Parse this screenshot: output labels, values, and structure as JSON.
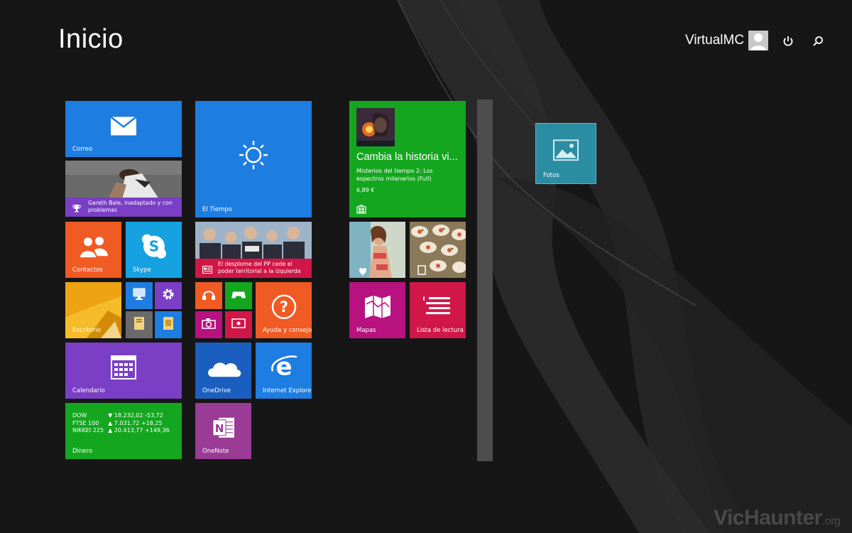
{
  "header": {
    "title": "Inicio",
    "username": "VirtualMC"
  },
  "tiles": {
    "correo": "Correo",
    "news_bale": "Gareth Bale, inadaptado y con problemas",
    "tiempo": "El Tiempo",
    "contactos": "Contactos",
    "skype": "Skype",
    "news_pp": "El desplome del PP cede el poder territorial a la izquierda",
    "escritorio": "Escritorio",
    "ayuda": "Ayuda y consejos",
    "calendario": "Calendario",
    "onedrive": "OneDrive",
    "ie": "Internet Explorer",
    "onenote": "OneNote",
    "dinero": "Dinero",
    "mapas": "Mapas",
    "lectura": "Lista de lectura",
    "fotos": "Fotos"
  },
  "store": {
    "headline": "Cambia la historia vi...",
    "subtitle": "Misterios del tiempo 2: Los espectros milenarios (Full)",
    "price": "6,89 €"
  },
  "markets": [
    {
      "name": "DOW",
      "arrow": "▼",
      "value": "18.232,02",
      "change": "-53,72"
    },
    {
      "name": "FTSE 100",
      "arrow": "▲",
      "value": "7.031,72",
      "change": "+18,25"
    },
    {
      "name": "NIKKEI 225",
      "arrow": "▲",
      "value": "20.413,77",
      "change": "+149,36"
    }
  ],
  "watermark": {
    "brand": "VicHaunter",
    "tld": ".org"
  },
  "colors": {
    "blue": "#1e7de0",
    "orange": "#f05a23",
    "purple": "#7a3fc4",
    "green": "#14a61f",
    "magenta": "#b7127f",
    "crimson": "#d01748",
    "teal": "#2b8da1",
    "onenote": "#9a3b95"
  },
  "icons": [
    "mail-icon",
    "sun-icon",
    "people-icon",
    "skype-icon",
    "help-icon",
    "calendar-icon",
    "cloud-icon",
    "ie-icon",
    "onenote-icon",
    "maps-icon",
    "reading-list-icon",
    "photos-icon",
    "store-icon",
    "power-icon",
    "search-icon",
    "user-icon",
    "trophy-icon",
    "news-icon"
  ]
}
